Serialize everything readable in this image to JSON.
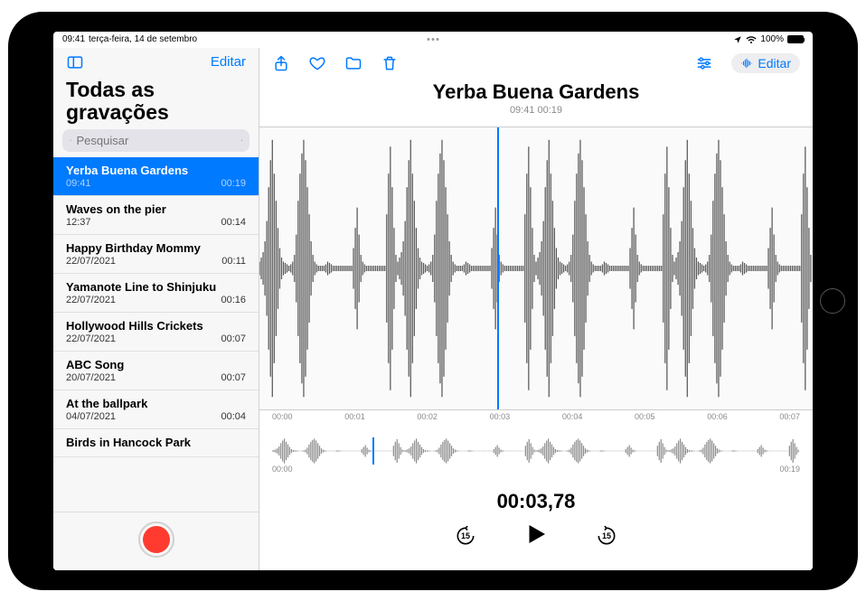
{
  "status": {
    "time": "09:41",
    "date": "terça-feira, 14 de setembro",
    "battery": "100%"
  },
  "sidebar": {
    "edit": "Editar",
    "title": "Todas as gravações",
    "search_placeholder": "Pesquisar",
    "items": [
      {
        "name": "Yerba Buena Gardens",
        "sub": "09:41",
        "dur": "00:19",
        "selected": true
      },
      {
        "name": "Waves on the pier",
        "sub": "12:37",
        "dur": "00:14"
      },
      {
        "name": "Happy Birthday Mommy",
        "sub": "22/07/2021",
        "dur": "00:11"
      },
      {
        "name": "Yamanote Line to Shinjuku",
        "sub": "22/07/2021",
        "dur": "00:16"
      },
      {
        "name": "Hollywood Hills Crickets",
        "sub": "22/07/2021",
        "dur": "00:07"
      },
      {
        "name": "ABC Song",
        "sub": "20/07/2021",
        "dur": "00:07"
      },
      {
        "name": "At the ballpark",
        "sub": "04/07/2021",
        "dur": "00:04"
      },
      {
        "name": "Birds in Hancock Park",
        "sub": "",
        "dur": ""
      }
    ]
  },
  "main": {
    "edit": "Editar",
    "title": "Yerba Buena Gardens",
    "subtitle": "09:41  00:19",
    "timeline": [
      "00:00",
      "00:01",
      "00:02",
      "00:03",
      "00:04",
      "00:05",
      "00:06",
      "00:07"
    ],
    "mini_start": "00:00",
    "mini_end": "00:19",
    "time_display": "00:03,78",
    "skip_seconds": "15"
  }
}
